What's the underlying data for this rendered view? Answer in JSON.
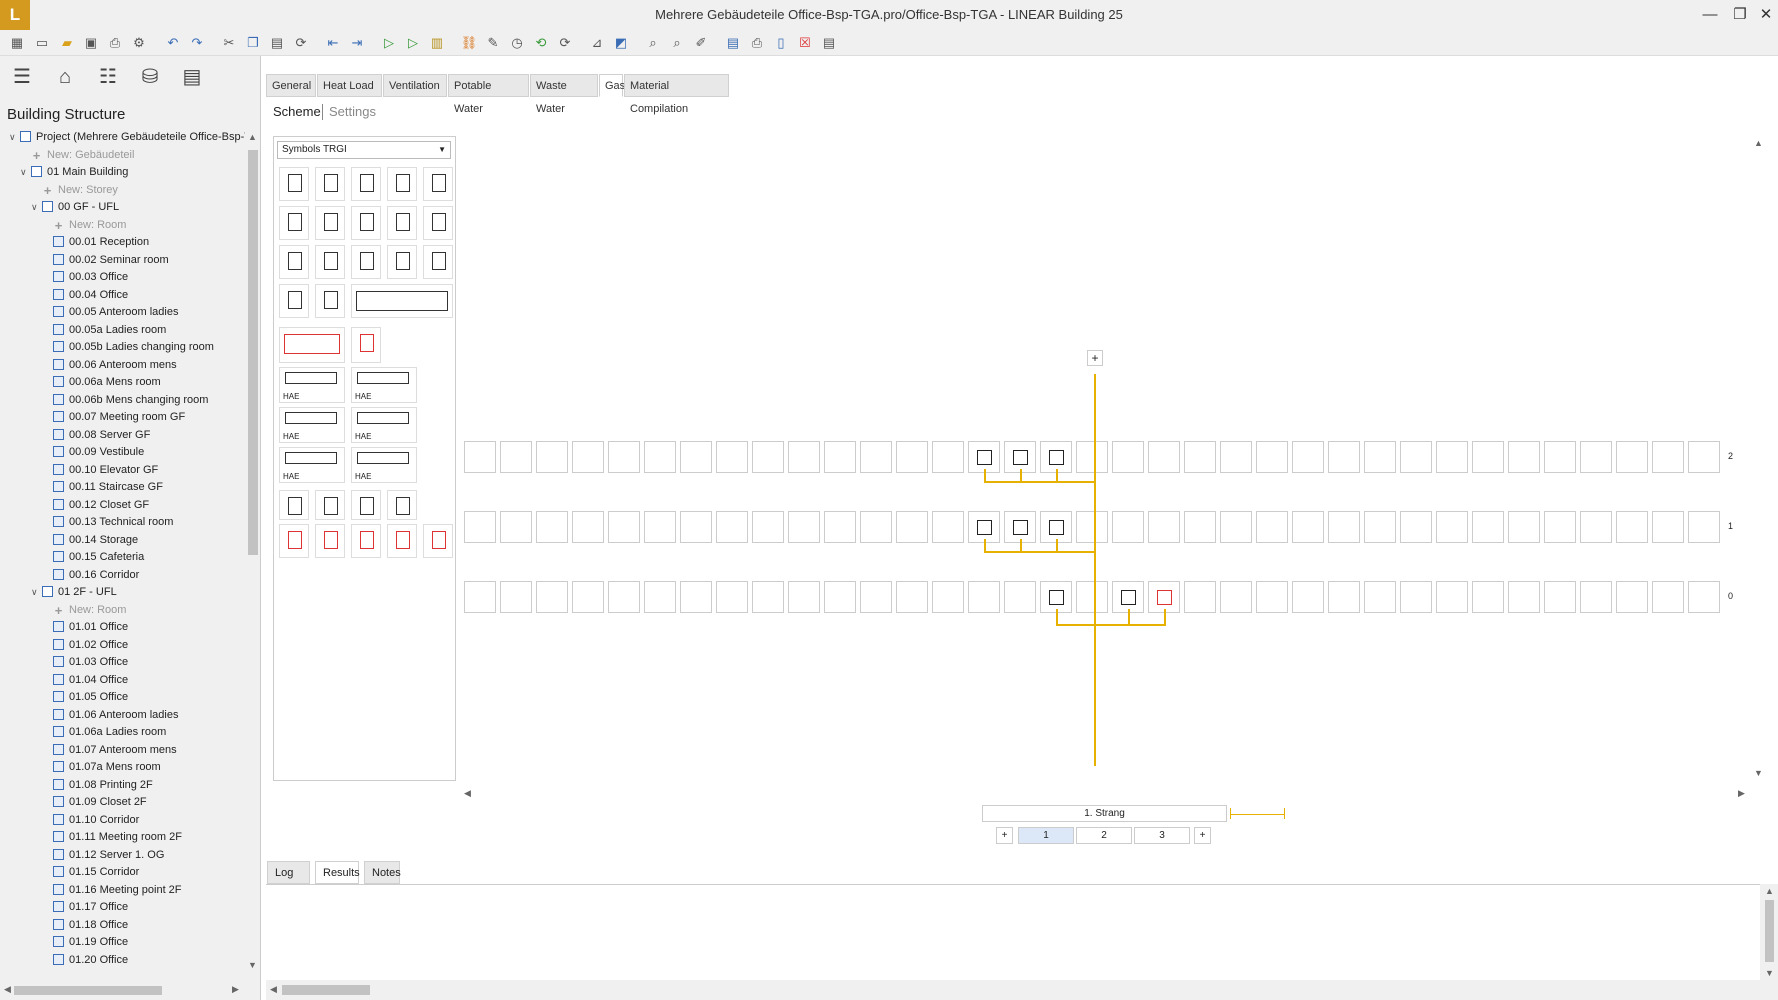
{
  "titlebar": {
    "logo": "L",
    "title": "Mehrere Gebäudeteile Office-Bsp-TGA.pro/Office-Bsp-TGA - LINEAR Building 25"
  },
  "sidebar": {
    "title": "Building Structure",
    "tree": [
      {
        "label": "Project (Mehrere Gebäudeteile Office-Bsp-TGA)",
        "level": 0,
        "kind": "project"
      },
      {
        "label": "New: Gebäudeteil",
        "level": 1,
        "kind": "new"
      },
      {
        "label": "01 Main Building",
        "level": 1,
        "kind": "building"
      },
      {
        "label": "New: Storey",
        "level": 2,
        "kind": "new"
      },
      {
        "label": "00 GF - UFL",
        "level": 2,
        "kind": "storey"
      },
      {
        "label": "New: Room",
        "level": 3,
        "kind": "new"
      },
      {
        "label": "00.01 Reception",
        "level": 3,
        "kind": "room"
      },
      {
        "label": "00.02 Seminar room",
        "level": 3,
        "kind": "room"
      },
      {
        "label": "00.03 Office",
        "level": 3,
        "kind": "room"
      },
      {
        "label": "00.04 Office",
        "level": 3,
        "kind": "room"
      },
      {
        "label": "00.05 Anteroom ladies",
        "level": 3,
        "kind": "room"
      },
      {
        "label": "00.05a Ladies room",
        "level": 3,
        "kind": "room"
      },
      {
        "label": "00.05b Ladies changing room",
        "level": 3,
        "kind": "room"
      },
      {
        "label": "00.06 Anteroom mens",
        "level": 3,
        "kind": "room"
      },
      {
        "label": "00.06a Mens room",
        "level": 3,
        "kind": "room"
      },
      {
        "label": "00.06b Mens changing room",
        "level": 3,
        "kind": "room"
      },
      {
        "label": "00.07 Meeting room GF",
        "level": 3,
        "kind": "room"
      },
      {
        "label": "00.08 Server GF",
        "level": 3,
        "kind": "room"
      },
      {
        "label": "00.09 Vestibule",
        "level": 3,
        "kind": "room"
      },
      {
        "label": "00.10 Elevator GF",
        "level": 3,
        "kind": "room"
      },
      {
        "label": "00.11 Staircase GF",
        "level": 3,
        "kind": "room"
      },
      {
        "label": "00.12 Closet GF",
        "level": 3,
        "kind": "room"
      },
      {
        "label": "00.13 Technical room",
        "level": 3,
        "kind": "room"
      },
      {
        "label": "00.14 Storage",
        "level": 3,
        "kind": "room"
      },
      {
        "label": "00.15 Cafeteria",
        "level": 3,
        "kind": "room"
      },
      {
        "label": "00.16 Corridor",
        "level": 3,
        "kind": "room"
      },
      {
        "label": "01 2F - UFL",
        "level": 2,
        "kind": "storey"
      },
      {
        "label": "New: Room",
        "level": 3,
        "kind": "new"
      },
      {
        "label": "01.01 Office",
        "level": 3,
        "kind": "room"
      },
      {
        "label": "01.02 Office",
        "level": 3,
        "kind": "room"
      },
      {
        "label": "01.03 Office",
        "level": 3,
        "kind": "room"
      },
      {
        "label": "01.04 Office",
        "level": 3,
        "kind": "room"
      },
      {
        "label": "01.05 Office",
        "level": 3,
        "kind": "room"
      },
      {
        "label": "01.06 Anteroom ladies",
        "level": 3,
        "kind": "room"
      },
      {
        "label": "01.06a Ladies room",
        "level": 3,
        "kind": "room"
      },
      {
        "label": "01.07 Anteroom mens",
        "level": 3,
        "kind": "room"
      },
      {
        "label": "01.07a Mens room",
        "level": 3,
        "kind": "room"
      },
      {
        "label": "01.08 Printing 2F",
        "level": 3,
        "kind": "room"
      },
      {
        "label": "01.09 Closet 2F",
        "level": 3,
        "kind": "room"
      },
      {
        "label": "01.10 Corridor",
        "level": 3,
        "kind": "room"
      },
      {
        "label": "01.11 Meeting room 2F",
        "level": 3,
        "kind": "room"
      },
      {
        "label": "01.12 Server 1. OG",
        "level": 3,
        "kind": "room"
      },
      {
        "label": "01.15 Corridor",
        "level": 3,
        "kind": "room"
      },
      {
        "label": "01.16 Meeting point 2F",
        "level": 3,
        "kind": "room"
      },
      {
        "label": "01.17 Office",
        "level": 3,
        "kind": "room"
      },
      {
        "label": "01.18 Office",
        "level": 3,
        "kind": "room"
      },
      {
        "label": "01.19 Office",
        "level": 3,
        "kind": "room"
      },
      {
        "label": "01.20 Office",
        "level": 3,
        "kind": "room"
      }
    ]
  },
  "tabs": [
    "General",
    "Heat Load",
    "Ventilation",
    "Potable Water",
    "Waste Water",
    "Gas",
    "Material Compilation"
  ],
  "active_tab": "Gas",
  "subtabs": {
    "scheme": "Scheme",
    "settings": "Settings"
  },
  "symbols": {
    "select_label": "Symbols TRGI",
    "hae_label": "HAE"
  },
  "scheme": {
    "row_labels": [
      "2",
      "1",
      "0"
    ],
    "add_symbol": "+"
  },
  "strang": {
    "label": "1. Strang",
    "pages": [
      "1",
      "2",
      "3"
    ],
    "add": "+"
  },
  "bottom_tabs": [
    "Log",
    "Results",
    "Notes"
  ],
  "active_bottom_tab": "Results",
  "colors": {
    "pipe": "#e6b100",
    "accent": "#d39a1f",
    "active_page": "#dce8f7"
  }
}
